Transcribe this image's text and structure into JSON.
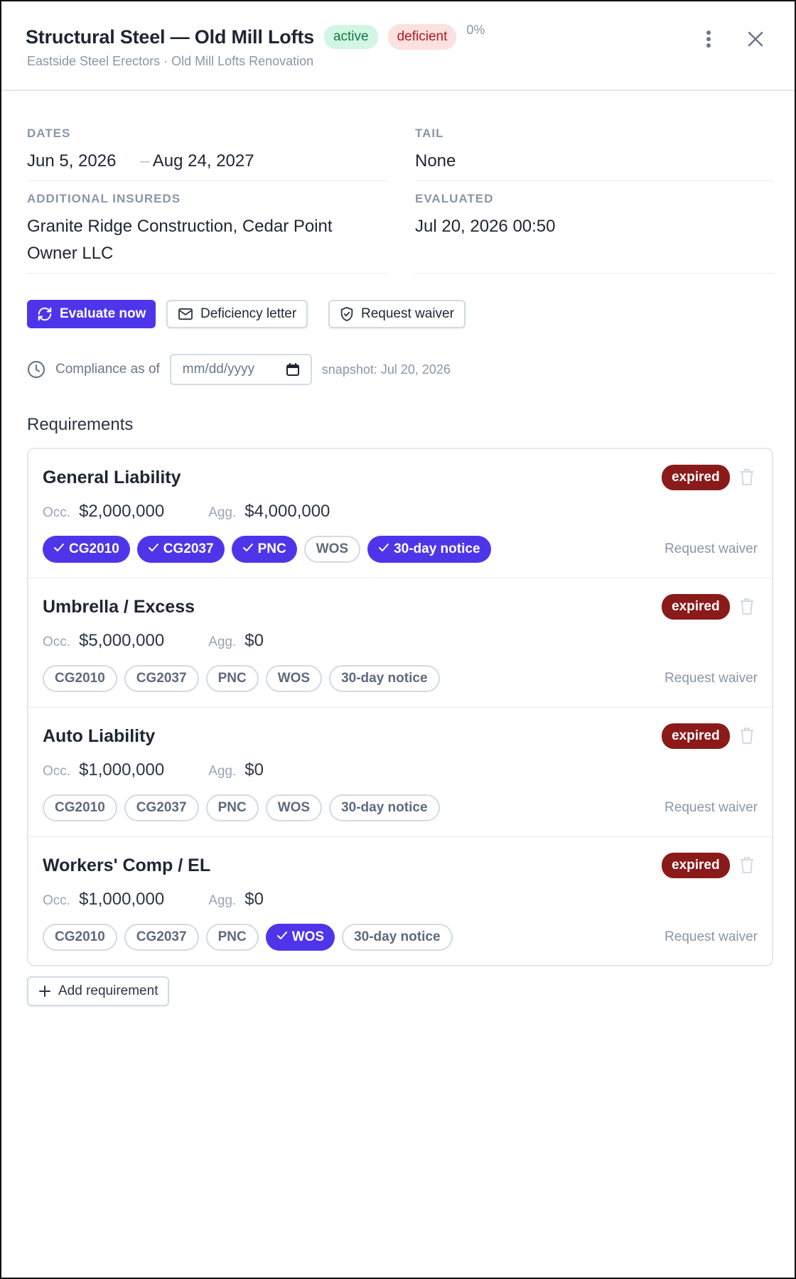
{
  "header": {
    "title": "Structural Steel — Old Mill Lofts",
    "status_active": "active",
    "status_deficient": "deficient",
    "compliance_pct": "0%",
    "subtitle": "Eastside Steel Erectors · Old Mill Lofts Renovation",
    "more_icon": "more-vertical-icon",
    "close_icon": "close-icon"
  },
  "info": {
    "dates_label": "DATES",
    "start_date": "Jun 5, 2026",
    "dash": "–",
    "end_date": "Aug 24, 2027",
    "tail_label": "TAIL",
    "tail_value": "None",
    "additional_insureds_label": "ADDITIONAL INSUREDS",
    "additional_insureds_value": "Granite Ridge Construction, Cedar Point Owner LLC",
    "evaluated_label": "EVALUATED",
    "evaluated_value": "Jul 20, 2026 00:50"
  },
  "actions": {
    "evaluate_now": "Evaluate now",
    "deficiency_letter": "Deficiency letter",
    "request_waiver": "Request waiver"
  },
  "compliance": {
    "label": "Compliance as of",
    "date_placeholder": "mm/dd/yyyy",
    "snapshot": "snapshot: Jul 20, 2026"
  },
  "requirements": {
    "title": "Requirements",
    "occ_label": "Occ.",
    "agg_label": "Agg.",
    "waiver_label": "Request waiver",
    "items": [
      {
        "name": "General Liability",
        "status": "expired",
        "occ": "$2,000,000",
        "agg": "$4,000,000",
        "chips": [
          {
            "label": "CG2010",
            "checked": true
          },
          {
            "label": "CG2037",
            "checked": true
          },
          {
            "label": "PNC",
            "checked": true
          },
          {
            "label": "WOS",
            "checked": false
          },
          {
            "label": "30-day notice",
            "checked": true
          }
        ]
      },
      {
        "name": "Umbrella / Excess",
        "status": "expired",
        "occ": "$5,000,000",
        "agg": "$0",
        "chips": [
          {
            "label": "CG2010",
            "checked": false
          },
          {
            "label": "CG2037",
            "checked": false
          },
          {
            "label": "PNC",
            "checked": false
          },
          {
            "label": "WOS",
            "checked": false
          },
          {
            "label": "30-day notice",
            "checked": false
          }
        ]
      },
      {
        "name": "Auto Liability",
        "status": "expired",
        "occ": "$1,000,000",
        "agg": "$0",
        "chips": [
          {
            "label": "CG2010",
            "checked": false
          },
          {
            "label": "CG2037",
            "checked": false
          },
          {
            "label": "PNC",
            "checked": false
          },
          {
            "label": "WOS",
            "checked": false
          },
          {
            "label": "30-day notice",
            "checked": false
          }
        ]
      },
      {
        "name": "Workers' Comp / EL",
        "status": "expired",
        "occ": "$1,000,000",
        "agg": "$0",
        "chips": [
          {
            "label": "CG2010",
            "checked": false
          },
          {
            "label": "CG2037",
            "checked": false
          },
          {
            "label": "PNC",
            "checked": false
          },
          {
            "label": "WOS",
            "checked": true
          },
          {
            "label": "30-day notice",
            "checked": false
          }
        ]
      }
    ],
    "add_label": "Add requirement"
  },
  "colors": {
    "accent": "#4f35ea",
    "expired": "#8b1a1a",
    "active_bg": "#d3f5e4",
    "deficient_bg": "#fde0e0"
  }
}
